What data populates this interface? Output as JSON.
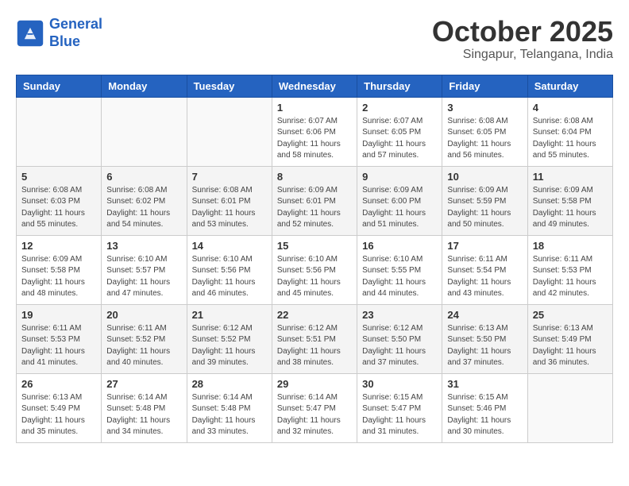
{
  "header": {
    "logo_line1": "General",
    "logo_line2": "Blue",
    "month": "October 2025",
    "location": "Singapur, Telangana, India"
  },
  "weekdays": [
    "Sunday",
    "Monday",
    "Tuesday",
    "Wednesday",
    "Thursday",
    "Friday",
    "Saturday"
  ],
  "weeks": [
    [
      {
        "day": "",
        "info": ""
      },
      {
        "day": "",
        "info": ""
      },
      {
        "day": "",
        "info": ""
      },
      {
        "day": "1",
        "info": "Sunrise: 6:07 AM\nSunset: 6:06 PM\nDaylight: 11 hours\nand 58 minutes."
      },
      {
        "day": "2",
        "info": "Sunrise: 6:07 AM\nSunset: 6:05 PM\nDaylight: 11 hours\nand 57 minutes."
      },
      {
        "day": "3",
        "info": "Sunrise: 6:08 AM\nSunset: 6:05 PM\nDaylight: 11 hours\nand 56 minutes."
      },
      {
        "day": "4",
        "info": "Sunrise: 6:08 AM\nSunset: 6:04 PM\nDaylight: 11 hours\nand 55 minutes."
      }
    ],
    [
      {
        "day": "5",
        "info": "Sunrise: 6:08 AM\nSunset: 6:03 PM\nDaylight: 11 hours\nand 55 minutes."
      },
      {
        "day": "6",
        "info": "Sunrise: 6:08 AM\nSunset: 6:02 PM\nDaylight: 11 hours\nand 54 minutes."
      },
      {
        "day": "7",
        "info": "Sunrise: 6:08 AM\nSunset: 6:01 PM\nDaylight: 11 hours\nand 53 minutes."
      },
      {
        "day": "8",
        "info": "Sunrise: 6:09 AM\nSunset: 6:01 PM\nDaylight: 11 hours\nand 52 minutes."
      },
      {
        "day": "9",
        "info": "Sunrise: 6:09 AM\nSunset: 6:00 PM\nDaylight: 11 hours\nand 51 minutes."
      },
      {
        "day": "10",
        "info": "Sunrise: 6:09 AM\nSunset: 5:59 PM\nDaylight: 11 hours\nand 50 minutes."
      },
      {
        "day": "11",
        "info": "Sunrise: 6:09 AM\nSunset: 5:58 PM\nDaylight: 11 hours\nand 49 minutes."
      }
    ],
    [
      {
        "day": "12",
        "info": "Sunrise: 6:09 AM\nSunset: 5:58 PM\nDaylight: 11 hours\nand 48 minutes."
      },
      {
        "day": "13",
        "info": "Sunrise: 6:10 AM\nSunset: 5:57 PM\nDaylight: 11 hours\nand 47 minutes."
      },
      {
        "day": "14",
        "info": "Sunrise: 6:10 AM\nSunset: 5:56 PM\nDaylight: 11 hours\nand 46 minutes."
      },
      {
        "day": "15",
        "info": "Sunrise: 6:10 AM\nSunset: 5:56 PM\nDaylight: 11 hours\nand 45 minutes."
      },
      {
        "day": "16",
        "info": "Sunrise: 6:10 AM\nSunset: 5:55 PM\nDaylight: 11 hours\nand 44 minutes."
      },
      {
        "day": "17",
        "info": "Sunrise: 6:11 AM\nSunset: 5:54 PM\nDaylight: 11 hours\nand 43 minutes."
      },
      {
        "day": "18",
        "info": "Sunrise: 6:11 AM\nSunset: 5:53 PM\nDaylight: 11 hours\nand 42 minutes."
      }
    ],
    [
      {
        "day": "19",
        "info": "Sunrise: 6:11 AM\nSunset: 5:53 PM\nDaylight: 11 hours\nand 41 minutes."
      },
      {
        "day": "20",
        "info": "Sunrise: 6:11 AM\nSunset: 5:52 PM\nDaylight: 11 hours\nand 40 minutes."
      },
      {
        "day": "21",
        "info": "Sunrise: 6:12 AM\nSunset: 5:52 PM\nDaylight: 11 hours\nand 39 minutes."
      },
      {
        "day": "22",
        "info": "Sunrise: 6:12 AM\nSunset: 5:51 PM\nDaylight: 11 hours\nand 38 minutes."
      },
      {
        "day": "23",
        "info": "Sunrise: 6:12 AM\nSunset: 5:50 PM\nDaylight: 11 hours\nand 37 minutes."
      },
      {
        "day": "24",
        "info": "Sunrise: 6:13 AM\nSunset: 5:50 PM\nDaylight: 11 hours\nand 37 minutes."
      },
      {
        "day": "25",
        "info": "Sunrise: 6:13 AM\nSunset: 5:49 PM\nDaylight: 11 hours\nand 36 minutes."
      }
    ],
    [
      {
        "day": "26",
        "info": "Sunrise: 6:13 AM\nSunset: 5:49 PM\nDaylight: 11 hours\nand 35 minutes."
      },
      {
        "day": "27",
        "info": "Sunrise: 6:14 AM\nSunset: 5:48 PM\nDaylight: 11 hours\nand 34 minutes."
      },
      {
        "day": "28",
        "info": "Sunrise: 6:14 AM\nSunset: 5:48 PM\nDaylight: 11 hours\nand 33 minutes."
      },
      {
        "day": "29",
        "info": "Sunrise: 6:14 AM\nSunset: 5:47 PM\nDaylight: 11 hours\nand 32 minutes."
      },
      {
        "day": "30",
        "info": "Sunrise: 6:15 AM\nSunset: 5:47 PM\nDaylight: 11 hours\nand 31 minutes."
      },
      {
        "day": "31",
        "info": "Sunrise: 6:15 AM\nSunset: 5:46 PM\nDaylight: 11 hours\nand 30 minutes."
      },
      {
        "day": "",
        "info": ""
      }
    ]
  ]
}
